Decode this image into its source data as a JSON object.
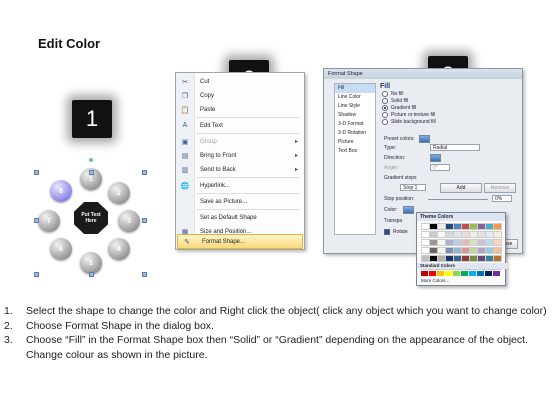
{
  "title": "Edit Color",
  "badges": [
    "1",
    "2",
    "3"
  ],
  "diagram": {
    "nodes": [
      "8",
      "1",
      "2",
      "3",
      "4",
      "5",
      "6",
      "7"
    ],
    "hub": [
      "Put Text",
      "Here"
    ]
  },
  "context_menu": {
    "items": [
      {
        "icon": "cut-icon",
        "label": "Cut",
        "disabled": false
      },
      {
        "icon": "copy-icon",
        "label": "Copy",
        "disabled": false
      },
      {
        "icon": "paste-icon",
        "label": "Paste",
        "disabled": false
      },
      {
        "icon": "edit-text-icon",
        "label": "Edit Text",
        "disabled": false
      },
      {
        "icon": "group-icon",
        "label": "Group",
        "disabled": true,
        "submenu": true
      },
      {
        "icon": "bring-front-icon",
        "label": "Bring to Front",
        "disabled": false,
        "submenu": true
      },
      {
        "icon": "send-back-icon",
        "label": "Send to Back",
        "disabled": false,
        "submenu": true
      },
      {
        "icon": "hyperlink-icon",
        "label": "Hyperlink...",
        "disabled": false
      },
      {
        "icon": "",
        "label": "Save as Picture...",
        "disabled": false
      },
      {
        "icon": "",
        "label": "Set as Default Shape",
        "disabled": false
      },
      {
        "icon": "size-icon",
        "label": "Size and Position...",
        "disabled": false
      },
      {
        "icon": "format-shape-icon",
        "label": "Format Shape...",
        "disabled": false,
        "highlighted": true
      }
    ]
  },
  "dialog": {
    "title": "Format Shape",
    "categories": [
      "Fill",
      "Line Color",
      "Line Style",
      "Shadow",
      "3-D Format",
      "3-D Rotation",
      "Picture",
      "Text Box"
    ],
    "selected_category": "Fill",
    "heading": "Fill",
    "fill_options": [
      {
        "label": "No fill",
        "on": false
      },
      {
        "label": "Solid fill",
        "on": false
      },
      {
        "label": "Gradient fill",
        "on": true
      },
      {
        "label": "Picture or texture fill",
        "on": false
      },
      {
        "label": "Slide background fill",
        "on": false
      }
    ],
    "preset_colors_label": "Preset colors:",
    "type_label": "Type:",
    "type_value": "Radial",
    "direction_label": "Direction:",
    "angle_label": "Angle:",
    "angle_value": "0°",
    "gradient_stops_label": "Gradient stops",
    "stop_value": "Stop 1",
    "add_label": "Add",
    "remove_label": "Remove",
    "stop_position_label": "Stop position:",
    "stop_position_value": "0%",
    "color_label": "Color:",
    "transparency_label": "Transpa",
    "rotate_label": "Rotate",
    "close_label": "Close"
  },
  "color_popup": {
    "theme_label": "Theme Colors",
    "standard_label": "Standard Colors",
    "more_label": "More Colors...",
    "theme_colors": [
      "#ffffff",
      "#000000",
      "#eeece1",
      "#1f497d",
      "#4f81bd",
      "#c0504d",
      "#9bbb59",
      "#8064a2",
      "#4bacc6",
      "#f79646"
    ],
    "standard_colors": [
      "#c00000",
      "#ff0000",
      "#ffc000",
      "#ffff00",
      "#92d050",
      "#00b050",
      "#00b0f0",
      "#0070c0",
      "#002060",
      "#7030a0"
    ]
  },
  "instructions": [
    {
      "num": "1.",
      "text": "Select the shape to change the color and Right click the object( click any object which you want to change color)"
    },
    {
      "num": "2.",
      "text": "Choose Format Shape in the dialog box."
    },
    {
      "num": "3.",
      "text": "Choose “Fill” in the Format Shape box then “Solid” or “Gradient” depending on the appearance of the object. Change colour as shown in the picture."
    }
  ]
}
